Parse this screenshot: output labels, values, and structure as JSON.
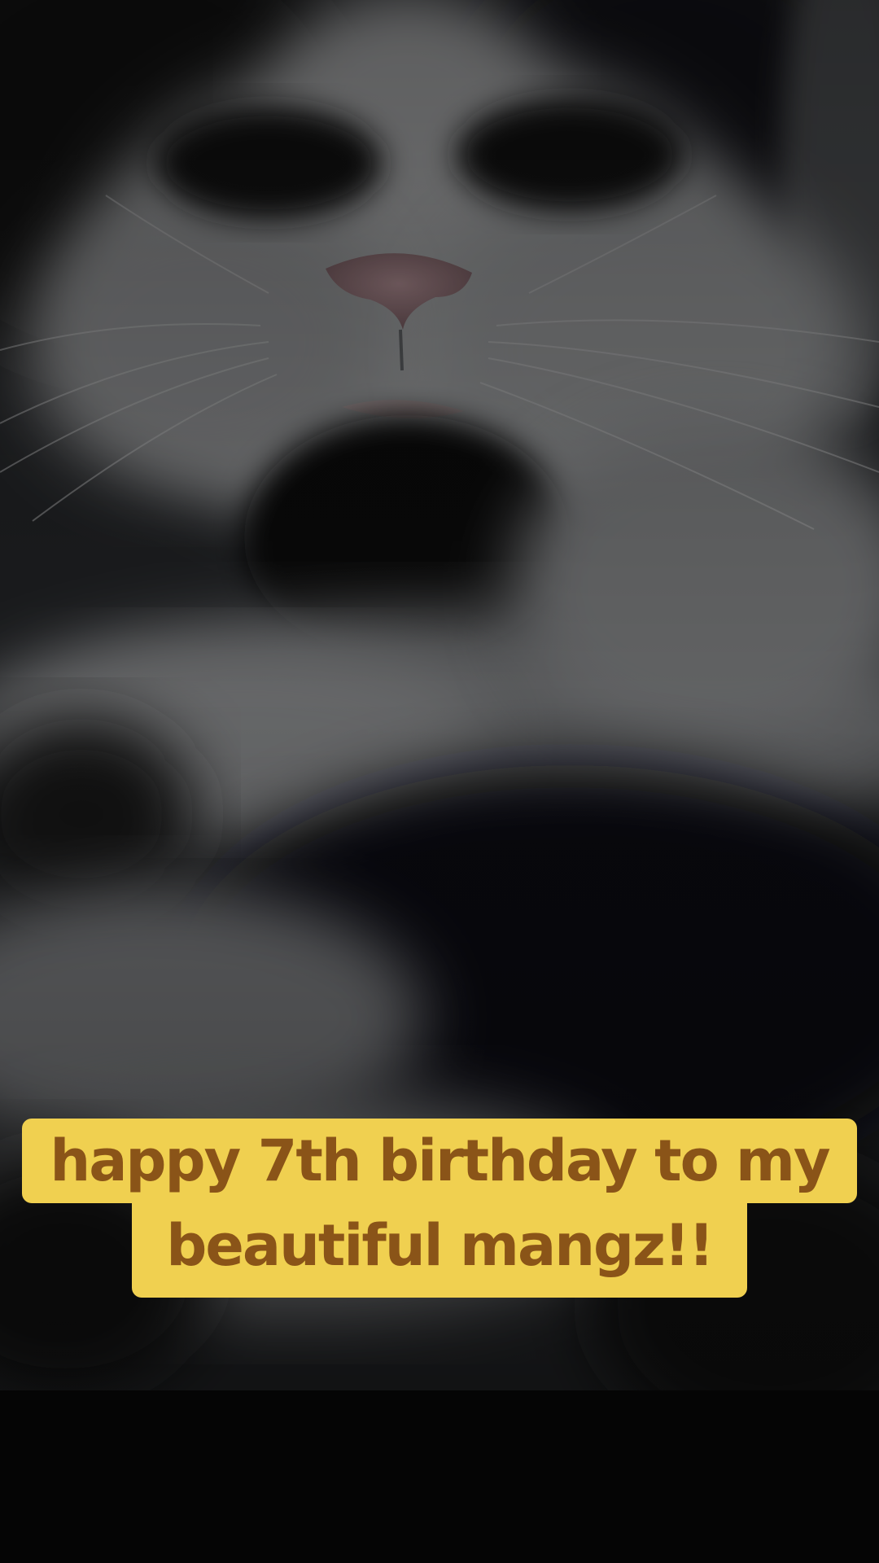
{
  "caption": {
    "line1": "happy 7th birthday to my",
    "line2": "beautiful mangz!!",
    "background_color": "#f0d050",
    "text_color": "#8a5418"
  },
  "photo": {
    "subject": "close-up of a sleeping black and white cat"
  }
}
